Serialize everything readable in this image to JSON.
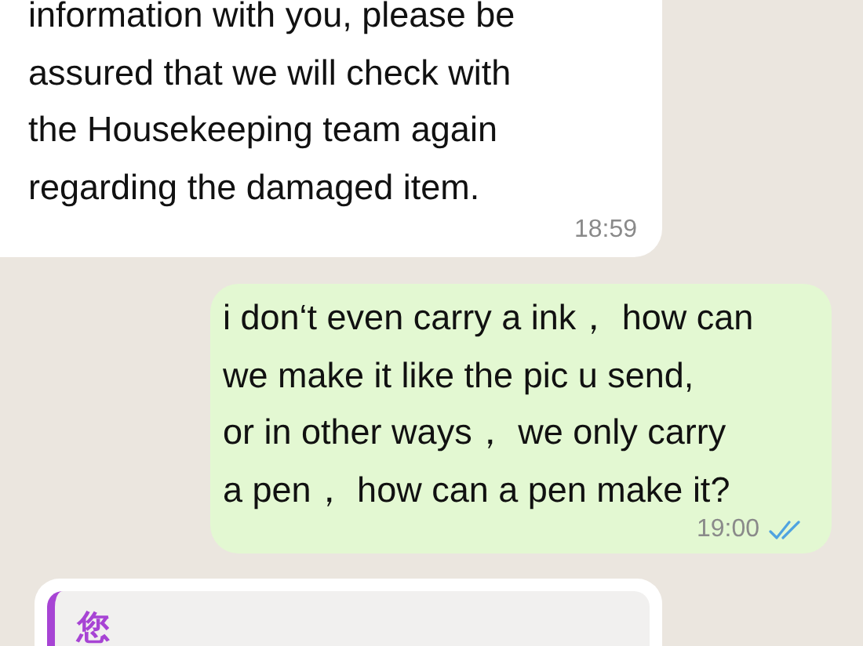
{
  "messages": [
    {
      "kind": "incoming",
      "lines": [
        "information with you, please be",
        "assured that we will check with",
        "the Housekeeping team again",
        "regarding the damaged item."
      ],
      "time": "18:59"
    },
    {
      "kind": "outgoing",
      "lines": [
        "i don‘t even carry a ink， how can",
        "we make it like the pic u send,",
        "or in other ways， we only carry",
        "a pen， how can a pen make it?"
      ],
      "time": "19:00",
      "read": true
    },
    {
      "kind": "reply",
      "quoted_author": "您"
    }
  ]
}
